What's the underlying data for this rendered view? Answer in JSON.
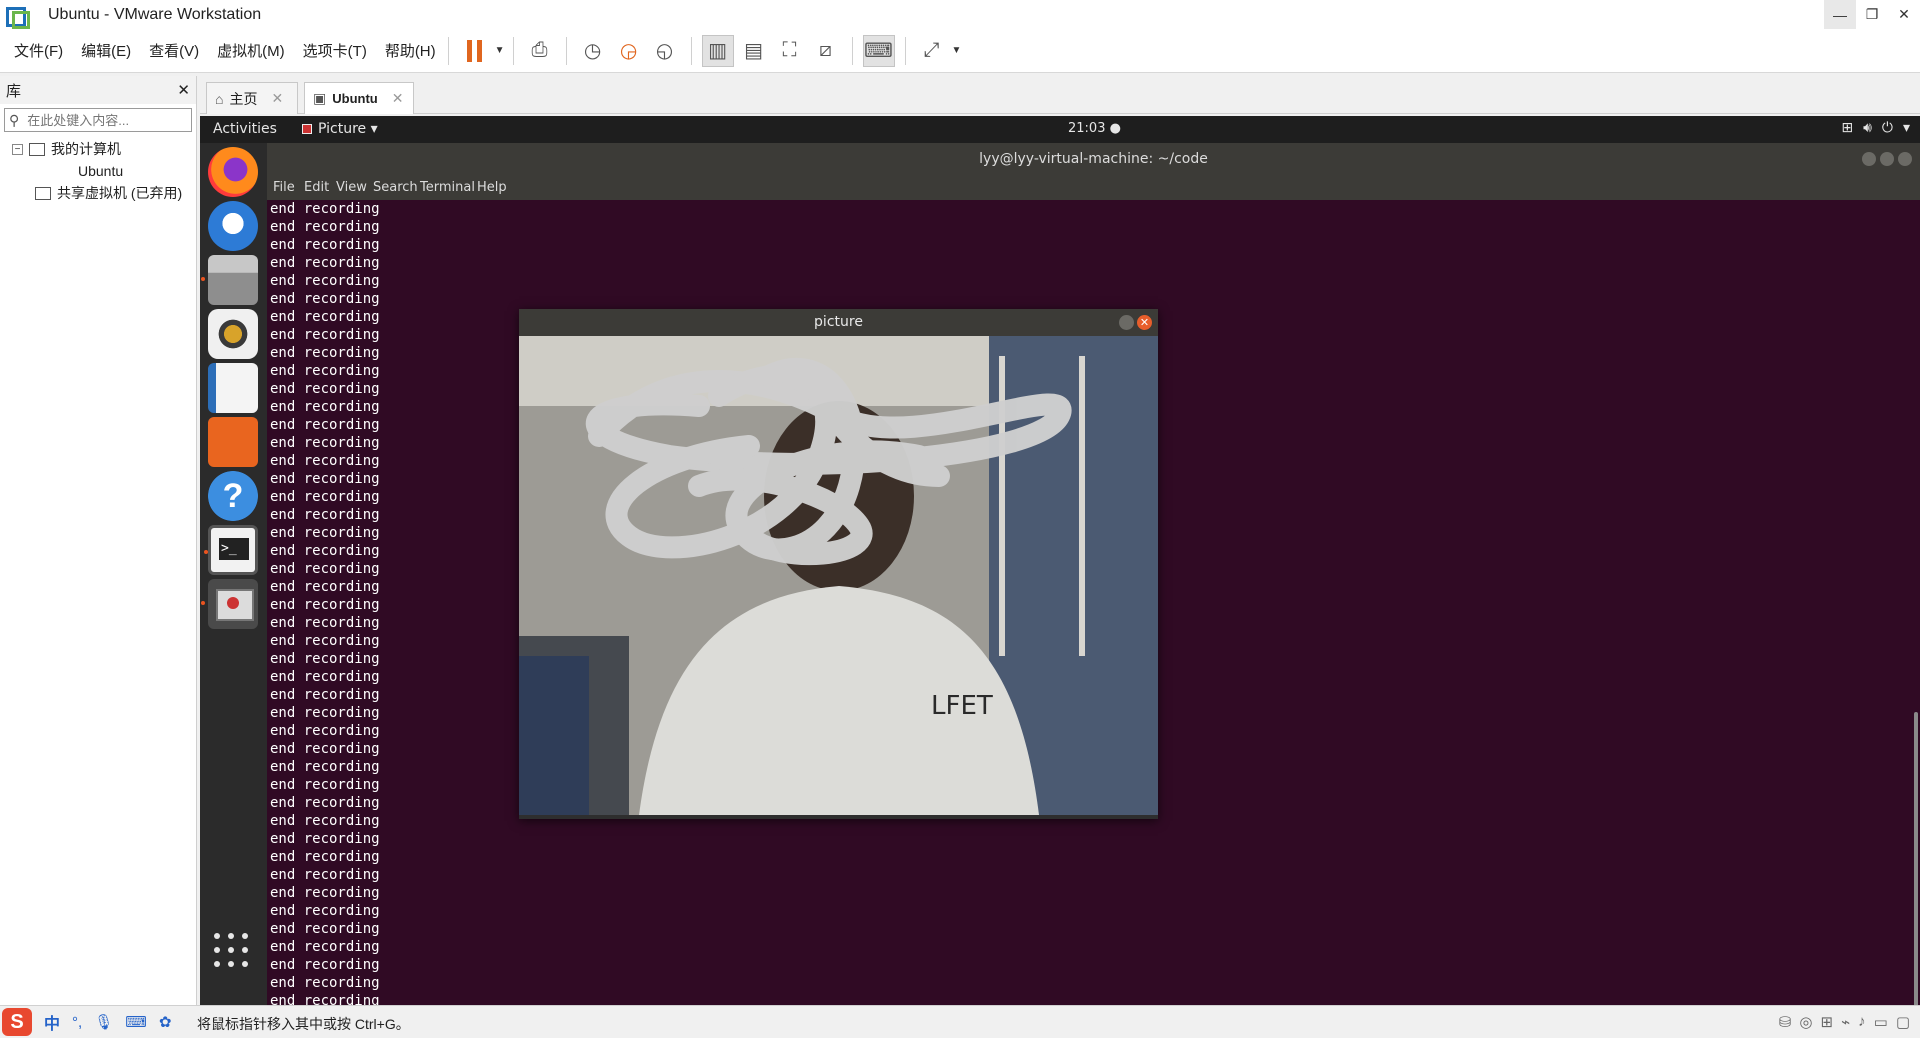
{
  "window": {
    "title": "Ubuntu - VMware Workstation"
  },
  "menu": [
    "文件(F)",
    "编辑(E)",
    "查看(V)",
    "虚拟机(M)",
    "选项卡(T)",
    "帮助(H)"
  ],
  "library": {
    "title": "库",
    "search_placeholder": "在此处键入内容...",
    "tree": {
      "my_computer": "我的计算机",
      "vm": "Ubuntu",
      "shared": "共享虚拟机 (已弃用)"
    }
  },
  "tabs": {
    "home": "主页",
    "ubuntu": "Ubuntu"
  },
  "gnome": {
    "activities": "Activities",
    "app_menu": "Picture",
    "clock": "21:03"
  },
  "terminal": {
    "title": "lyy@lyy-virtual-machine: ~/code",
    "menu": [
      "File",
      "Edit",
      "View",
      "Search",
      "Terminal",
      "Help"
    ],
    "partial_line": "end re",
    "full_line": "end recording"
  },
  "picture_window": {
    "title": "picture",
    "shirt_text": "LFET"
  },
  "status": {
    "hint": "将鼠标指针移入其中或按 Ctrl+G。",
    "ime_lang": "中"
  },
  "colors": {
    "terminal_bg": "#300a24",
    "accent": "#e95420",
    "pause": "#e0661f"
  }
}
